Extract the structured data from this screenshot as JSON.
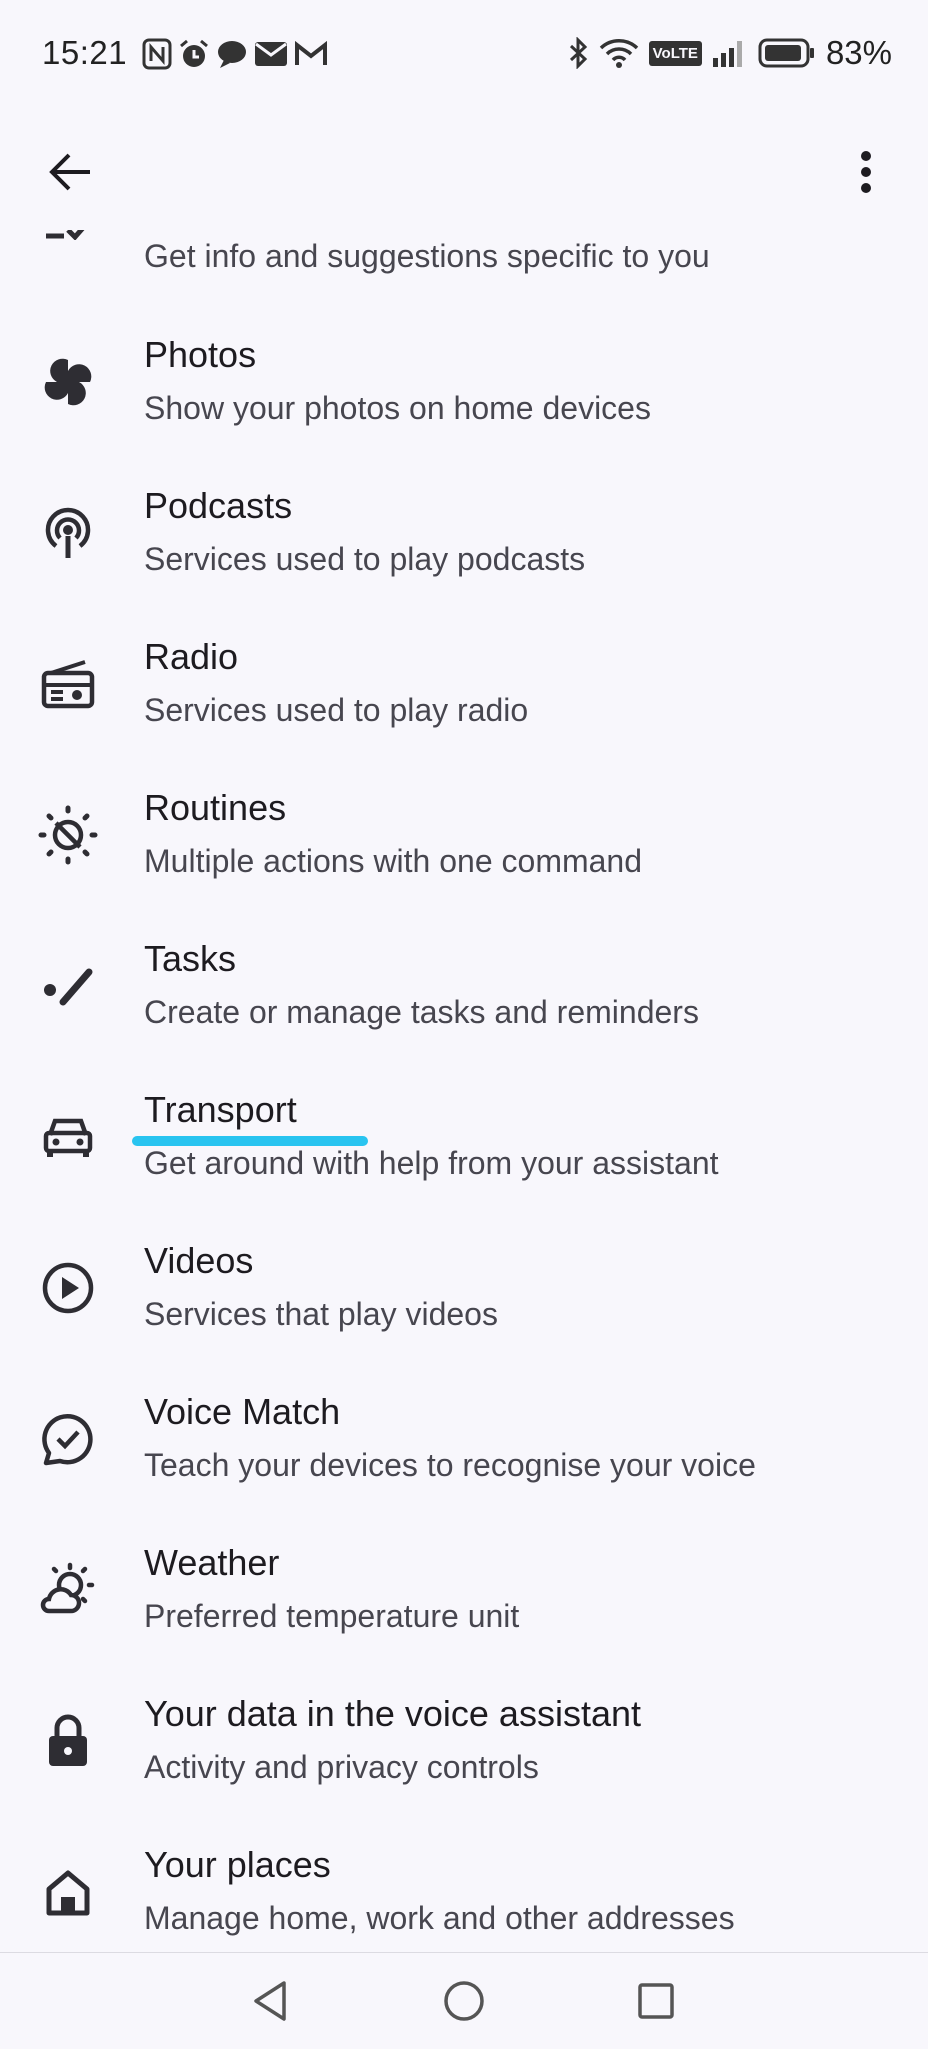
{
  "status_bar": {
    "time": "15:21",
    "notification_icons": [
      "nfc-icon",
      "alarm-icon",
      "chat-icon",
      "mail-icon",
      "gmail-icon"
    ],
    "system_icons": [
      "bluetooth-icon",
      "wifi-icon",
      "volte-icon",
      "signal-icon",
      "battery-icon"
    ],
    "volte_label": "VoLTE",
    "battery": "83%"
  },
  "toolbar": {
    "back_icon": "arrow-back-icon",
    "more_icon": "more-vert-icon"
  },
  "items": [
    {
      "title": "",
      "subtitle": "Get info and suggestions specific to you",
      "icon": "personal-results-icon"
    },
    {
      "title": "Photos",
      "subtitle": "Show your photos on home devices",
      "icon": "pinwheel-icon"
    },
    {
      "title": "Podcasts",
      "subtitle": "Services used to play podcasts",
      "icon": "podcast-icon"
    },
    {
      "title": "Radio",
      "subtitle": "Services used to play radio",
      "icon": "radio-icon"
    },
    {
      "title": "Routines",
      "subtitle": "Multiple actions with one command",
      "icon": "routines-icon"
    },
    {
      "title": "Tasks",
      "subtitle": "Create or manage tasks and reminders",
      "icon": "tasks-icon"
    },
    {
      "title": "Transport",
      "subtitle": "Get around with help from your assistant",
      "icon": "car-icon"
    },
    {
      "title": "Videos",
      "subtitle": "Services that play videos",
      "icon": "play-circle-icon"
    },
    {
      "title": "Voice Match",
      "subtitle": "Teach your devices to recognise your voice",
      "icon": "voice-match-icon"
    },
    {
      "title": "Weather",
      "subtitle": "Preferred temperature unit",
      "icon": "weather-icon"
    },
    {
      "title": "Your data in the voice assistant",
      "subtitle": "Activity and privacy controls",
      "icon": "lock-icon"
    },
    {
      "title": "Your places",
      "subtitle": "Manage home, work and other addresses",
      "icon": "home-icon"
    }
  ],
  "annotation": {
    "highlight_color": "#29c4f0"
  },
  "nav_bar": {
    "icons": [
      "back-triangle-icon",
      "home-circle-icon",
      "recents-square-icon"
    ]
  }
}
